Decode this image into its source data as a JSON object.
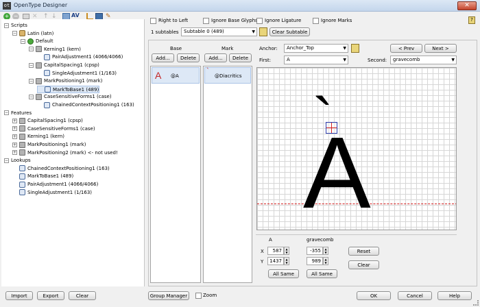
{
  "window": {
    "title": "OpenType Designer",
    "app_icon_glyph": "ot"
  },
  "toolbar": {
    "icons": [
      "add-icon",
      "remove-icon",
      "new-lookup-icon",
      "delete-icon",
      "move-up-icon",
      "move-down-icon",
      "font-lookup-icon",
      "kerning-icon",
      "tree-view-icon",
      "table-view-icon",
      "clean-icon"
    ]
  },
  "tree": {
    "nodes": [
      {
        "label": "Scripts",
        "depth": 0,
        "exp": "−",
        "icon": ""
      },
      {
        "label": "Latin (latn)",
        "depth": 1,
        "exp": "−",
        "icon": "lang"
      },
      {
        "label": "Default",
        "depth": 2,
        "exp": "−",
        "icon": "globe"
      },
      {
        "label": "Kerning1 (kern)",
        "depth": 3,
        "exp": "−",
        "icon": "feat"
      },
      {
        "label": "PairAdjustment1 (4066/4066)",
        "depth": 4,
        "exp": "",
        "icon": "lookup"
      },
      {
        "label": "CapitalSpacing1 (cpsp)",
        "depth": 3,
        "exp": "−",
        "icon": "feat"
      },
      {
        "label": "SingleAdjustment1 (1/163)",
        "depth": 4,
        "exp": "",
        "icon": "lookup"
      },
      {
        "label": "MarkPositioning1 (mark)",
        "depth": 3,
        "exp": "−",
        "icon": "feat"
      },
      {
        "label": "MarkToBase1 (489)",
        "depth": 4,
        "exp": "",
        "icon": "lookup",
        "selected": true
      },
      {
        "label": "CaseSensitiveForms1 (case)",
        "depth": 3,
        "exp": "−",
        "icon": "feat"
      },
      {
        "label": "ChainedContextPositioning1 (163)",
        "depth": 4,
        "exp": "",
        "icon": "lookup"
      },
      {
        "label": "Features",
        "depth": 0,
        "exp": "−",
        "icon": ""
      },
      {
        "label": "CapitalSpacing1 (cpsp)",
        "depth": 1,
        "exp": "+",
        "icon": "feat"
      },
      {
        "label": "CaseSensitiveForms1 (case)",
        "depth": 1,
        "exp": "+",
        "icon": "feat"
      },
      {
        "label": "Kerning1 (kern)",
        "depth": 1,
        "exp": "+",
        "icon": "feat"
      },
      {
        "label": "MarkPositioning1 (mark)",
        "depth": 1,
        "exp": "+",
        "icon": "feat"
      },
      {
        "label": "MarkPositioning2 (mark) <- not used!",
        "depth": 1,
        "exp": "+",
        "icon": "feat"
      },
      {
        "label": "Lookups",
        "depth": 0,
        "exp": "−",
        "icon": ""
      },
      {
        "label": "ChainedContextPositioning1 (163)",
        "depth": 1,
        "exp": "",
        "icon": "lookup"
      },
      {
        "label": "MarkToBase1 (489)",
        "depth": 1,
        "exp": "",
        "icon": "lookup"
      },
      {
        "label": "PairAdjustment1 (4066/4066)",
        "depth": 1,
        "exp": "",
        "icon": "lookup"
      },
      {
        "label": "SingleAdjustment1 (1/163)",
        "depth": 1,
        "exp": "",
        "icon": "lookup"
      }
    ]
  },
  "options": {
    "right_to_left": "Right to Left",
    "ignore_base": "Ignore Base Glyphs",
    "ignore_ligature": "Ignore Ligature",
    "ignore_marks": "Ignore Marks"
  },
  "subtables": {
    "count_label": "1 subtables",
    "selected": "Subtable 0 (489)",
    "clear": "Clear Subtable"
  },
  "base_col": {
    "header": "Base",
    "add": "Add...",
    "delete": "Delete",
    "glyph": "A",
    "item": "@A"
  },
  "mark_col": {
    "header": "Mark",
    "add": "Add...",
    "delete": "Delete",
    "glyph": "`",
    "item": "@Diacritics"
  },
  "anchor": {
    "label": "Anchor:",
    "value": "Anchor_Top",
    "prev": "< Prev",
    "next": "Next >",
    "first_label": "First:",
    "first_value": "A",
    "second_label": "Second:",
    "second_value": "gravecomb"
  },
  "preview": {
    "base_char": "A",
    "mark_char": "`",
    "accent_color": "#b91f1f"
  },
  "coords": {
    "col1": "A",
    "col2": "gravecomb",
    "x_label": "X",
    "y_label": "Y",
    "x1": "587",
    "y1": "1437",
    "x2": "-355",
    "y2": "989",
    "all_same": "All Same",
    "reset": "Reset",
    "clear": "Clear"
  },
  "footer": {
    "import": "Import",
    "export": "Export",
    "clear": "Clear",
    "group_manager": "Group Manager",
    "zoom": "Zoom",
    "ok": "OK",
    "cancel": "Cancel",
    "help": "Help"
  }
}
